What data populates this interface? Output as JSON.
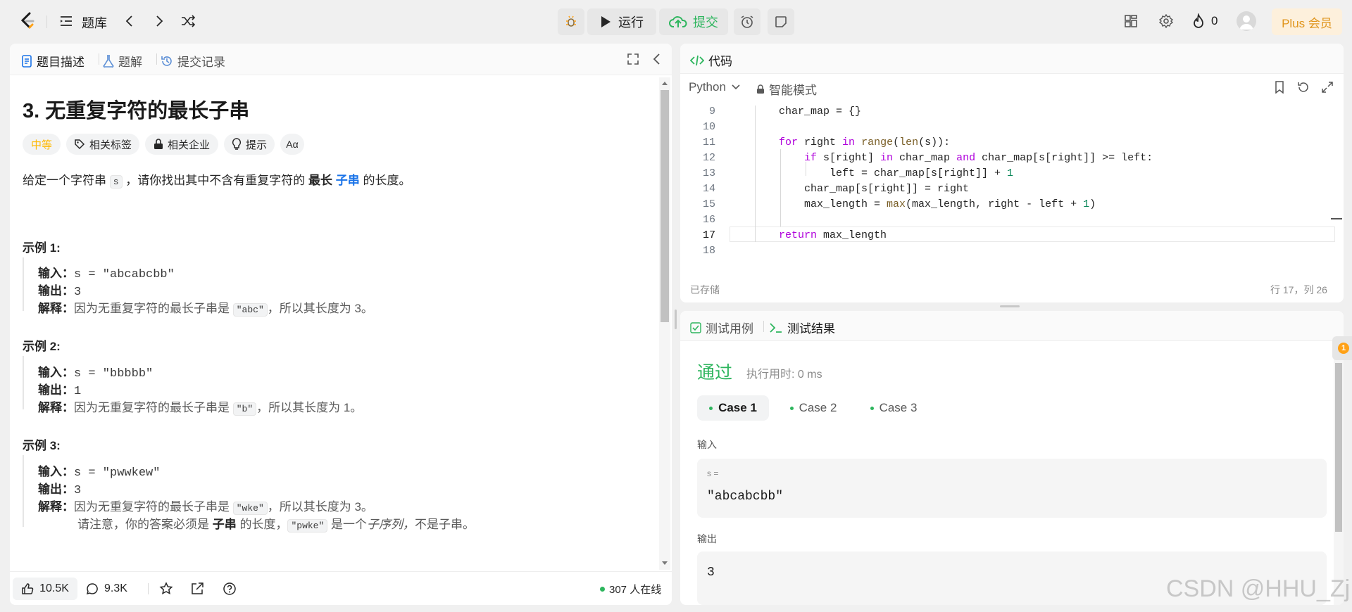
{
  "topbar": {
    "nav_label": "题库",
    "run_label": "运行",
    "submit_label": "提交",
    "fire_count": "0",
    "plus_label": "Plus 会员"
  },
  "left": {
    "tabs": [
      "题目描述",
      "题解",
      "提交记录"
    ],
    "title": "3. 无重复字符的最长子串",
    "tags": {
      "difficulty": "中等",
      "related_tags": "相关标签",
      "related_companies": "相关企业",
      "hints": "提示",
      "font_toggle": "Aα"
    },
    "desc": {
      "part1": "给定一个字符串 ",
      "var": "s",
      "part2": " ，请你找出其中不含有重复字符的 ",
      "bold": "最长",
      "link": "子串",
      "part3": " 的长度。"
    },
    "examples": [
      {
        "heading": "示例 1:",
        "in_label": "输入：",
        "in_val": "s = \"abcabcbb\"",
        "out_label": "输出：",
        "out_val": "3",
        "exp_label": "解释：",
        "exp_pre": "因为无重复字符的最长子串是 ",
        "exp_code": "\"abc\"",
        "exp_post": "，所以其长度为 3。"
      },
      {
        "heading": "示例 2:",
        "in_label": "输入：",
        "in_val": "s = \"bbbbb\"",
        "out_label": "输出：",
        "out_val": "1",
        "exp_label": "解释：",
        "exp_pre": "因为无重复字符的最长子串是 ",
        "exp_code": "\"b\"",
        "exp_post": "，所以其长度为 1。"
      },
      {
        "heading": "示例 3:",
        "in_label": "输入：",
        "in_val": "s = \"pwwkew\"",
        "out_label": "输出：",
        "out_val": "3",
        "exp_label": "解释：",
        "exp_pre": "因为无重复字符的最长子串是 ",
        "exp_code": "\"wke\"",
        "exp_post": "，所以其长度为 3。",
        "note_pre": "请注意，你的答案必须是 ",
        "note_bold": "子串",
        "note_mid": " 的长度，",
        "note_code": "\"pwke\"",
        "note_mid2": " 是一个",
        "note_italic": "子序列，",
        "note_post": "不是子串。"
      }
    ],
    "footer": {
      "likes": "10.5K",
      "comments": "9.3K",
      "online": "307 人在线"
    }
  },
  "code": {
    "header_label": "代码",
    "language": "Python",
    "mode": "智能模式",
    "lines": [
      {
        "n": "9"
      },
      {
        "n": "10"
      },
      {
        "n": "11"
      },
      {
        "n": "12"
      },
      {
        "n": "13"
      },
      {
        "n": "14"
      },
      {
        "n": "15"
      },
      {
        "n": "16"
      },
      {
        "n": "17"
      },
      {
        "n": "18"
      }
    ],
    "saved": "已存储",
    "cursor": "行 17，列 26"
  },
  "results": {
    "tab_cases": "测试用例",
    "tab_result": "测试结果",
    "status": "通过",
    "runtime": "执行用时: 0 ms",
    "cases": [
      "Case 1",
      "Case 2",
      "Case 3"
    ],
    "input_label": "输入",
    "input_var": "s =",
    "input_val": "\"abcabcbb\"",
    "output_label": "输出",
    "output_val": "3",
    "badge": "1"
  },
  "watermark": "CSDN @HHU_Zj",
  "colors": {
    "accent_blue": "#1a73e8",
    "success_green": "#2db55d",
    "difficulty_orange": "#ffb800",
    "plus_bg": "#fdf0dc",
    "plus_text": "#e0951c"
  }
}
